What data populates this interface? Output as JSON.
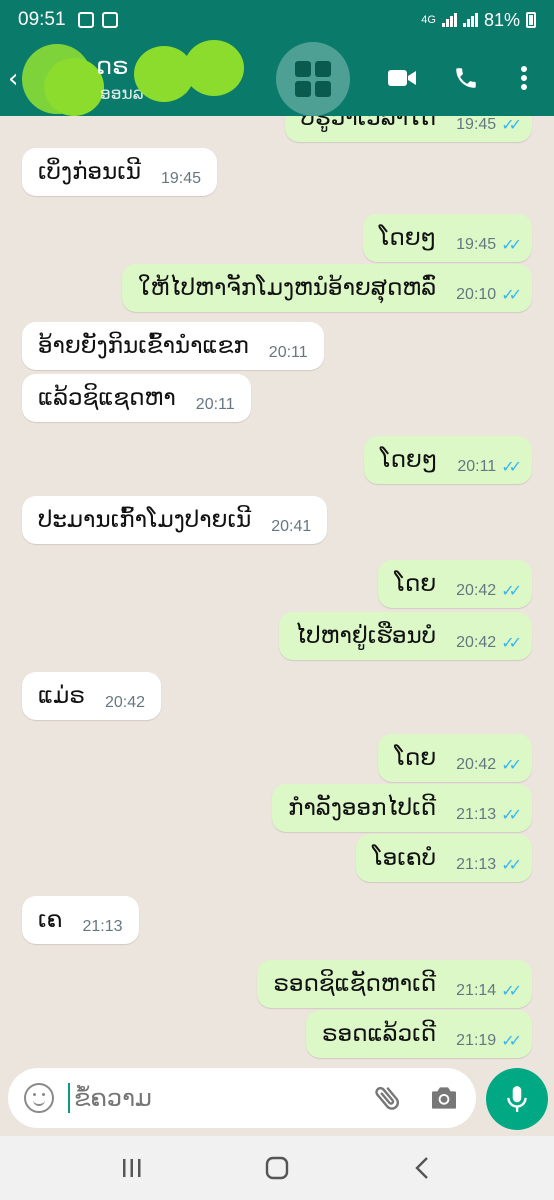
{
  "status_bar": {
    "time": "09:51",
    "network": "4G",
    "battery": "81%"
  },
  "header": {
    "contact_name": "ດຣ",
    "contact_status": "ອອນລາຍ"
  },
  "messages": [
    {
      "dir": "out",
      "text": "ບໍ່ຮູ້ວ່າເວລາໃດ",
      "time": "19:45",
      "ticks": "✓✓"
    },
    {
      "dir": "in",
      "text": "ເບິ່ງກ່ອນເນີ",
      "time": "19:45"
    },
    {
      "dir": "out",
      "text": "ໂດຍໆ",
      "time": "19:45",
      "ticks": "✓✓"
    },
    {
      "dir": "out",
      "text": "ໃຫ້ໄປຫາຈັກໂມງຫນໍອ້າຍສຸດຫລົ່",
      "time": "20:10",
      "ticks": "✓✓"
    },
    {
      "dir": "in",
      "text": "ອ້າຍຍັງກິນເຂົ້ານຳແຂກ",
      "time": "20:11"
    },
    {
      "dir": "in",
      "text": "ແລ້ວຊິແຊດຫາ",
      "time": "20:11"
    },
    {
      "dir": "out",
      "text": "ໂດຍໆ",
      "time": "20:11",
      "ticks": "✓✓"
    },
    {
      "dir": "in",
      "text": "ປະມານເກົ້າໂມງປາຍເນີ",
      "time": "20:41"
    },
    {
      "dir": "out",
      "text": "ໂດຍ",
      "time": "20:42",
      "ticks": "✓✓"
    },
    {
      "dir": "out",
      "text": "ໄປຫາຢູ່ເຮືອນບໍ",
      "time": "20:42",
      "ticks": "✓✓"
    },
    {
      "dir": "in",
      "text": "ແມ່ຣ",
      "time": "20:42"
    },
    {
      "dir": "out",
      "text": "ໂດຍ",
      "time": "20:42",
      "ticks": "✓✓"
    },
    {
      "dir": "out",
      "text": "ກຳລັງອອກໄປເດີ",
      "time": "21:13",
      "ticks": "✓✓"
    },
    {
      "dir": "out",
      "text": "ໂອເຄບໍ",
      "time": "21:13",
      "ticks": "✓✓"
    },
    {
      "dir": "in",
      "text": "ເຄ",
      "time": "21:13"
    },
    {
      "dir": "out",
      "text": "ຣອດຊິແຊັດຫາເດີ",
      "time": "21:14",
      "ticks": "✓✓"
    },
    {
      "dir": "out",
      "text": "ຣອດແລ້ວເດີ",
      "time": "21:19",
      "ticks": "✓✓"
    }
  ],
  "composer": {
    "placeholder": "ຂໍ້ຄວາມ"
  },
  "colors": {
    "header": "#0a7a6b",
    "outgoing": "#dcf8c6",
    "incoming": "#ffffff",
    "read_ticks": "#34b7f1",
    "mic": "#00a884"
  }
}
